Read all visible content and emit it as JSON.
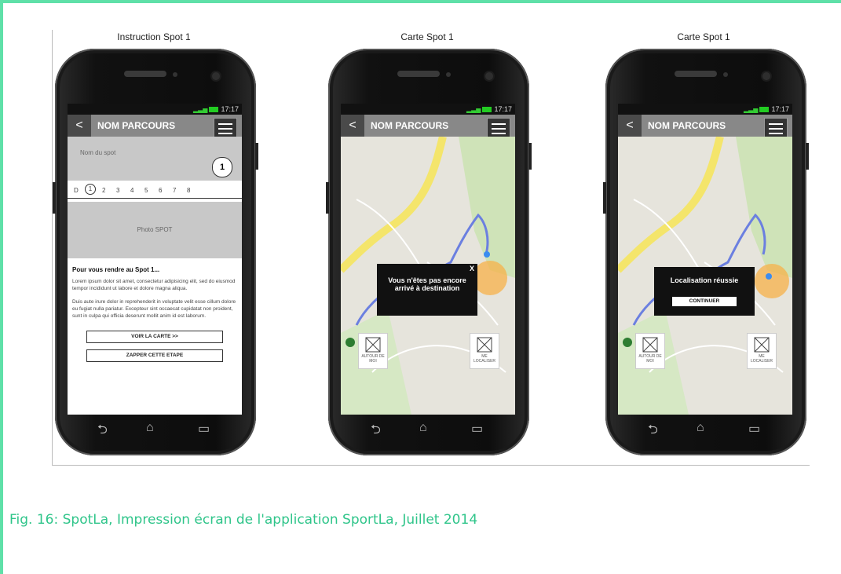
{
  "screens": [
    {
      "title": "Instruction Spot 1"
    },
    {
      "title": "Carte Spot 1"
    },
    {
      "title": "Carte Spot 1"
    }
  ],
  "status_time": "17:17",
  "appbar": {
    "back": "<",
    "title": "NOM PARCOURS"
  },
  "instruction": {
    "spot_name": "Nom du spot",
    "spot_number": "1",
    "steps": [
      "D",
      "1",
      "2",
      "3",
      "4",
      "5",
      "6",
      "7",
      "8"
    ],
    "photo_label": "Photo SPOT",
    "heading": "Pour vous rendre au Spot 1...",
    "para1": "Lorem ipsum dolor sit amet, consectetur adipisicing elit, sed do eiusmod tempor incididunt ut labore et dolore magna aliqua.",
    "para2": "Duis aute irure dolor in reprehenderit in voluptate velit esse cillum dolore eu fugiat nulla pariatur. Excepteur sint occaecat cupidatat non proident, sunt in culpa qui officia deserunt mollit anim id est laborum.",
    "btn_map": "VOIR LA CARTE >>",
    "btn_skip": "ZAPPER CETTE ETAPE"
  },
  "map1": {
    "dialog_close": "X",
    "dialog_msg": "Vous n'êtes pas encore arrivé à destination"
  },
  "map2": {
    "dialog_msg": "Localisation réussie",
    "dialog_btn": "CONTINUER"
  },
  "tiles": {
    "around": "AUTOUR DE MOI",
    "locate": "ME LOCALISER"
  },
  "caption": "Fig. 16: SpotLa, Impression écran de l'application SportLa, Juillet 2014",
  "colors": {
    "accent": "#2fc58a",
    "frame": "#5fe0a8",
    "route": "#6b7fe0",
    "road": "#f4e56b"
  }
}
